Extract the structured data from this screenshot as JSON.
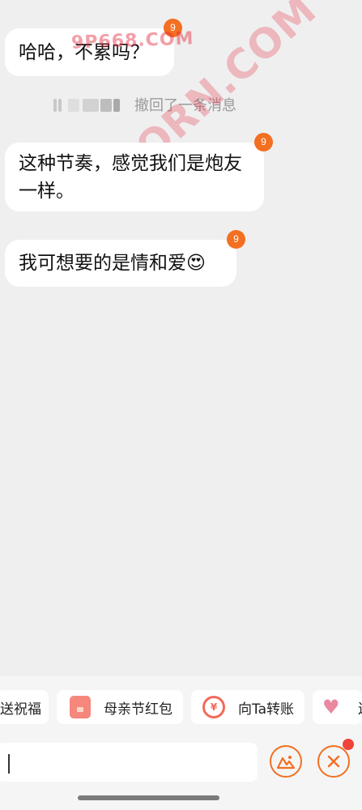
{
  "messages": [
    {
      "text": "哈哈，不累吗？",
      "badge": "9"
    },
    {
      "text": "这种节奏，感觉我们是炮友一样。",
      "badge": "9"
    },
    {
      "text": "我可想要的是情和爱😍",
      "badge": "9"
    }
  ],
  "recall_notice": "撤回了一条消息",
  "watermark": {
    "top": "9P668.COM",
    "diagonal": "9PORN.COM"
  },
  "quick_actions": [
    {
      "label": "送祝福",
      "icon": "blessing-icon"
    },
    {
      "label": "母亲节红包",
      "icon": "red-envelope-icon"
    },
    {
      "label": "向Ta转账",
      "icon": "transfer-icon"
    },
    {
      "label": "送",
      "icon": "gift-heart-icon"
    }
  ],
  "input": {
    "value": ""
  },
  "colors": {
    "accent": "#f36f21",
    "background": "#efefef",
    "bubble": "#ffffff",
    "watermark": "#e7283c"
  }
}
